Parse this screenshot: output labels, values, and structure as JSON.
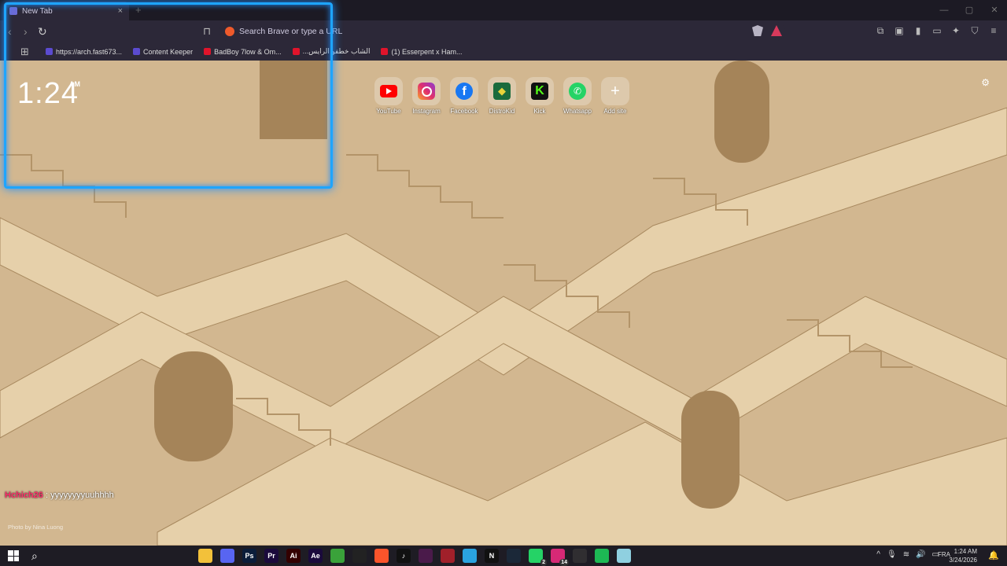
{
  "browser": {
    "tab_title": "New Tab",
    "tab_close": "×",
    "new_tab": "+",
    "window_controls": [
      "—",
      "▢",
      "✕"
    ],
    "url_placeholder": "Search Brave or type a URL",
    "bookmarks": [
      {
        "label": "https://arch.fast673...",
        "color": "#5b4bd0"
      },
      {
        "label": "Content Keeper",
        "color": "#5b4bd0"
      },
      {
        "label": "BadBoy 7low & Om...",
        "color": "#e0142b"
      },
      {
        "label": "...الشاب خطفو الرايس",
        "color": "#e0142b"
      },
      {
        "label": "(1) Esserpent x Ham...",
        "color": "#e0142b"
      }
    ]
  },
  "newtab": {
    "clock": "1:24",
    "ampm": "AM",
    "top_sites": [
      {
        "label": "YouTube",
        "icon": "youtube-icon"
      },
      {
        "label": "Instagram",
        "icon": "instagram-icon"
      },
      {
        "label": "Facebook",
        "icon": "facebook-icon"
      },
      {
        "label": "DistroKid",
        "icon": "distrokid-icon"
      },
      {
        "label": "Kick",
        "icon": "kick-icon"
      },
      {
        "label": "Whatsapp",
        "icon": "whatsapp-icon"
      },
      {
        "label": "Add site",
        "icon": "plus-icon"
      }
    ],
    "chat_user": "Hchich26",
    "chat_message": " : yyyyyyyyuuhhhh",
    "photo_credit": "Photo by Nina Luong"
  },
  "taskbar": {
    "lang": "FRA",
    "time": "1:24 AM",
    "date": "3/24/2026",
    "apps": [
      {
        "name": "file-explorer",
        "text": "",
        "color": "#f3c13a"
      },
      {
        "name": "discord",
        "text": "",
        "color": "#5865f2"
      },
      {
        "name": "photoshop",
        "text": "Ps",
        "color": "#0b1d3a"
      },
      {
        "name": "premiere",
        "text": "Pr",
        "color": "#1b0a3c"
      },
      {
        "name": "illustrator",
        "text": "Ai",
        "color": "#330000"
      },
      {
        "name": "after-effects",
        "text": "Ae",
        "color": "#1a0a3c"
      },
      {
        "name": "app-green",
        "text": "",
        "color": "#3aa23a"
      },
      {
        "name": "capcut",
        "text": "",
        "color": "#222"
      },
      {
        "name": "brave",
        "text": "",
        "color": "#fb542b"
      },
      {
        "name": "tiktok",
        "text": "♪",
        "color": "#111"
      },
      {
        "name": "app-purple",
        "text": "",
        "color": "#4a1a4a"
      },
      {
        "name": "app-red",
        "text": "",
        "color": "#a0202a"
      },
      {
        "name": "telegram",
        "text": "",
        "color": "#2aa3e0"
      },
      {
        "name": "netflix",
        "text": "N",
        "color": "#111"
      },
      {
        "name": "steam",
        "text": "",
        "color": "#1b2838"
      },
      {
        "name": "whatsapp",
        "text": "",
        "color": "#25d366",
        "badge": "2"
      },
      {
        "name": "instagram",
        "text": "",
        "color": "#d62976",
        "badge": "14"
      },
      {
        "name": "obs",
        "text": "",
        "color": "#302e31"
      },
      {
        "name": "spotify",
        "text": "",
        "color": "#1db954"
      },
      {
        "name": "app-light",
        "text": "",
        "color": "#8fd0e0"
      }
    ]
  }
}
